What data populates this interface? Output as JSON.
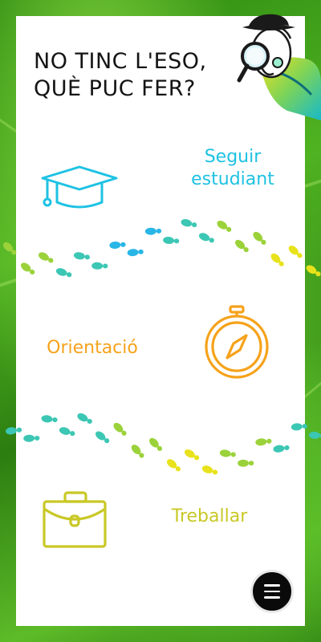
{
  "page": {
    "title_line1": "NO TINC L'ESO,",
    "title_line2": "QUÈ PUC FER?"
  },
  "options": {
    "study_line1": "Seguir",
    "study_line2": "estudiant",
    "orientation": "Orientació",
    "work": "Treballar"
  },
  "colors": {
    "study": "#1ec2e3",
    "orientation": "#f6a21a",
    "work": "#c9c826",
    "footprint_green": "#9bd23a",
    "footprint_teal": "#3cc7b4",
    "footprint_blue": "#28b6e6",
    "footprint_yellow": "#e8e21c"
  },
  "icons": {
    "study": "graduation-cap-icon",
    "orientation": "compass-icon",
    "work": "briefcase-icon",
    "menu": "hamburger-menu-icon",
    "mascot": "detective-mascot-with-magnifier"
  }
}
